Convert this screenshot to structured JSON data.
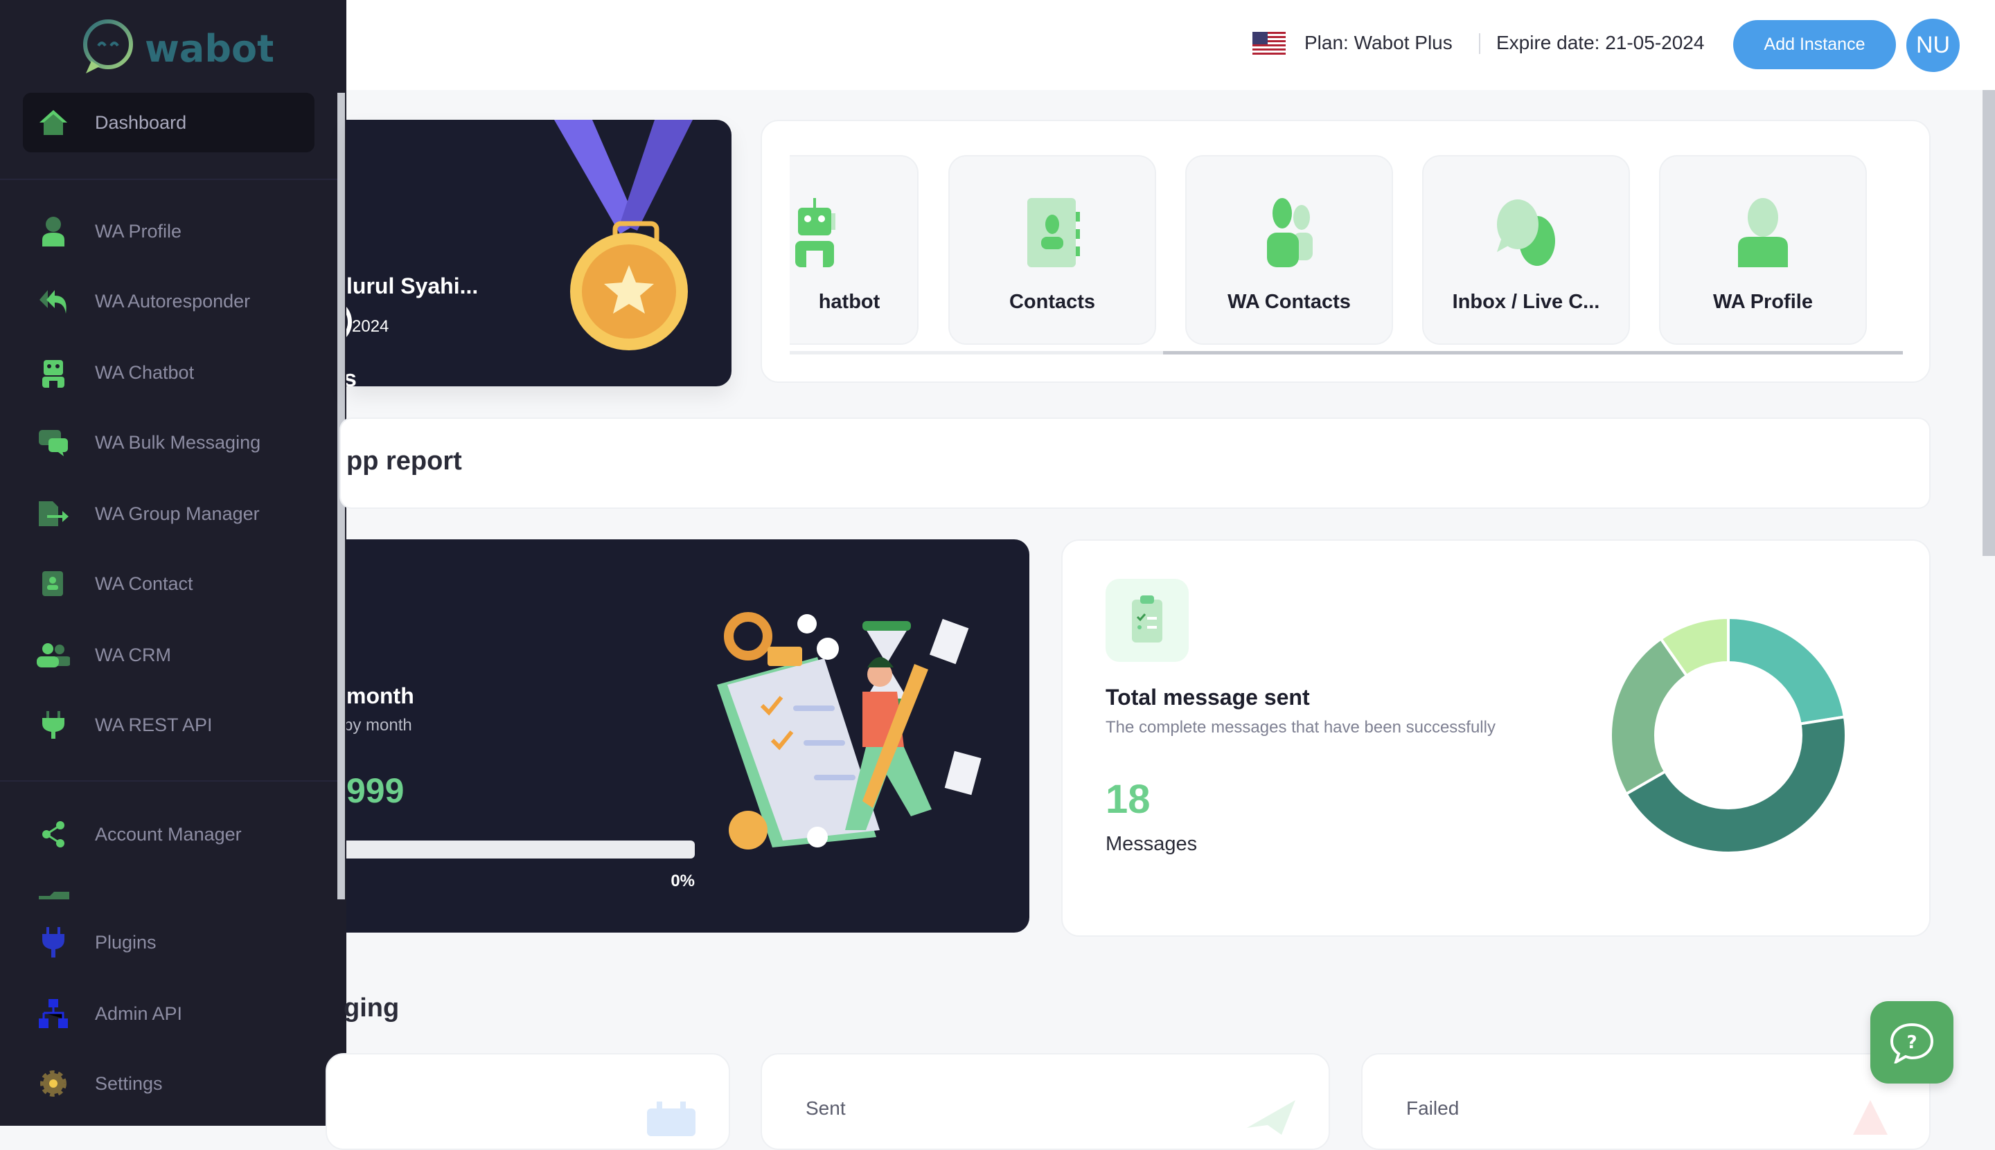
{
  "brand": {
    "logo_text": "wabot"
  },
  "sidebar": {
    "items": [
      {
        "label": "Dashboard",
        "icon": "home-icon"
      },
      {
        "label": "WA Profile",
        "icon": "user-icon"
      },
      {
        "label": "WA Autoresponder",
        "icon": "reply-all-icon"
      },
      {
        "label": "WA Chatbot",
        "icon": "robot-icon"
      },
      {
        "label": "WA Bulk Messaging",
        "icon": "chat-bubbles-icon"
      },
      {
        "label": "WA Group Manager",
        "icon": "file-export-icon"
      },
      {
        "label": "WA Contact",
        "icon": "address-book-icon"
      },
      {
        "label": "WA CRM",
        "icon": "users-icon"
      },
      {
        "label": "WA REST API",
        "icon": "plug-icon"
      },
      {
        "label": "Account Manager",
        "icon": "share-icon"
      },
      {
        "label": "Plugins",
        "icon": "plug-icon"
      },
      {
        "label": "Admin API",
        "icon": "sitemap-icon"
      },
      {
        "label": "Settings",
        "icon": "gear-icon"
      }
    ]
  },
  "header": {
    "flag": "us-flag-icon",
    "plan": "Plan: Wabot Plus",
    "expire": "Expire date: 21-05-2024",
    "add_instance": "Add Instance",
    "avatar": "NU",
    "accent": "#4a9eea"
  },
  "welcome": {
    "name": "lurul Syahi...",
    "date": "-2024",
    "line3": "s"
  },
  "shortcuts": [
    {
      "label": "hatbot",
      "icon": "robot-icon"
    },
    {
      "label": "Contacts",
      "icon": "address-book-icon"
    },
    {
      "label": "WA Contacts",
      "icon": "users-icon"
    },
    {
      "label": "Inbox / Live C...",
      "icon": "chat-bubbles-icon"
    },
    {
      "label": "WA Profile",
      "icon": "user-icon"
    }
  ],
  "report": {
    "title": "pp report"
  },
  "quota": {
    "title": "month",
    "subtitle": "by month",
    "value": "999",
    "progress_percent": 0,
    "progress_label": "0%"
  },
  "total": {
    "title": "Total message sent",
    "subtitle": "The complete messages that have been successfully",
    "value": "18",
    "unit": "Messages",
    "icon": "clipboard-check-icon"
  },
  "chart_data": {
    "type": "pie",
    "donut": true,
    "values": [
      22.5,
      44.2,
      23.6,
      9.7
    ],
    "colors": [
      "#5bc1b0",
      "#3a8173",
      "#7fb98f",
      "#c7f0a8"
    ]
  },
  "messaging": {
    "title": "ging",
    "cards": [
      {
        "label": ""
      },
      {
        "label": "Sent"
      },
      {
        "label": "Failed"
      }
    ]
  },
  "help": {
    "icon": "help-chat-icon",
    "color": "#55ab64"
  }
}
